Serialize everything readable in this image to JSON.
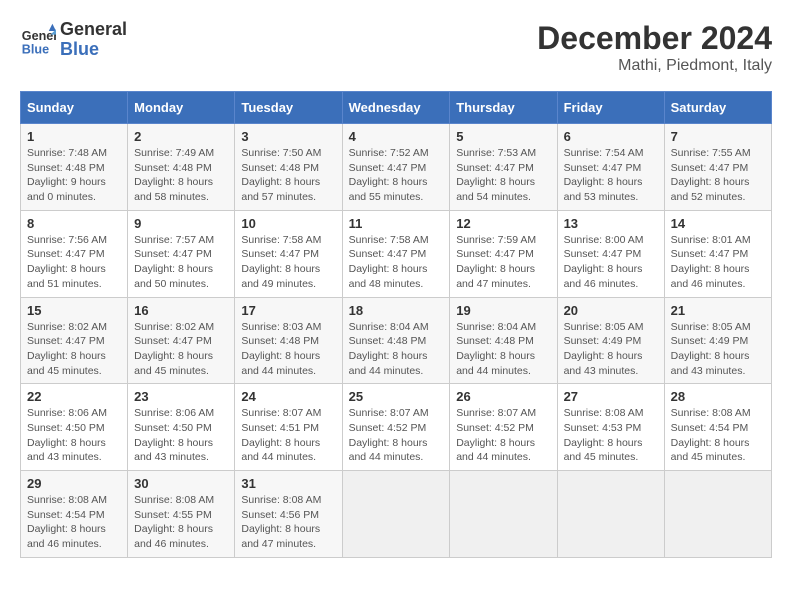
{
  "logo": {
    "line1": "General",
    "line2": "Blue"
  },
  "title": "December 2024",
  "location": "Mathi, Piedmont, Italy",
  "days_of_week": [
    "Sunday",
    "Monday",
    "Tuesday",
    "Wednesday",
    "Thursday",
    "Friday",
    "Saturday"
  ],
  "weeks": [
    [
      {
        "day": "1",
        "sunrise": "7:48 AM",
        "sunset": "4:48 PM",
        "daylight": "9 hours and 0 minutes."
      },
      {
        "day": "2",
        "sunrise": "7:49 AM",
        "sunset": "4:48 PM",
        "daylight": "8 hours and 58 minutes."
      },
      {
        "day": "3",
        "sunrise": "7:50 AM",
        "sunset": "4:48 PM",
        "daylight": "8 hours and 57 minutes."
      },
      {
        "day": "4",
        "sunrise": "7:52 AM",
        "sunset": "4:47 PM",
        "daylight": "8 hours and 55 minutes."
      },
      {
        "day": "5",
        "sunrise": "7:53 AM",
        "sunset": "4:47 PM",
        "daylight": "8 hours and 54 minutes."
      },
      {
        "day": "6",
        "sunrise": "7:54 AM",
        "sunset": "4:47 PM",
        "daylight": "8 hours and 53 minutes."
      },
      {
        "day": "7",
        "sunrise": "7:55 AM",
        "sunset": "4:47 PM",
        "daylight": "8 hours and 52 minutes."
      }
    ],
    [
      {
        "day": "8",
        "sunrise": "7:56 AM",
        "sunset": "4:47 PM",
        "daylight": "8 hours and 51 minutes."
      },
      {
        "day": "9",
        "sunrise": "7:57 AM",
        "sunset": "4:47 PM",
        "daylight": "8 hours and 50 minutes."
      },
      {
        "day": "10",
        "sunrise": "7:58 AM",
        "sunset": "4:47 PM",
        "daylight": "8 hours and 49 minutes."
      },
      {
        "day": "11",
        "sunrise": "7:58 AM",
        "sunset": "4:47 PM",
        "daylight": "8 hours and 48 minutes."
      },
      {
        "day": "12",
        "sunrise": "7:59 AM",
        "sunset": "4:47 PM",
        "daylight": "8 hours and 47 minutes."
      },
      {
        "day": "13",
        "sunrise": "8:00 AM",
        "sunset": "4:47 PM",
        "daylight": "8 hours and 46 minutes."
      },
      {
        "day": "14",
        "sunrise": "8:01 AM",
        "sunset": "4:47 PM",
        "daylight": "8 hours and 46 minutes."
      }
    ],
    [
      {
        "day": "15",
        "sunrise": "8:02 AM",
        "sunset": "4:47 PM",
        "daylight": "8 hours and 45 minutes."
      },
      {
        "day": "16",
        "sunrise": "8:02 AM",
        "sunset": "4:47 PM",
        "daylight": "8 hours and 45 minutes."
      },
      {
        "day": "17",
        "sunrise": "8:03 AM",
        "sunset": "4:48 PM",
        "daylight": "8 hours and 44 minutes."
      },
      {
        "day": "18",
        "sunrise": "8:04 AM",
        "sunset": "4:48 PM",
        "daylight": "8 hours and 44 minutes."
      },
      {
        "day": "19",
        "sunrise": "8:04 AM",
        "sunset": "4:48 PM",
        "daylight": "8 hours and 44 minutes."
      },
      {
        "day": "20",
        "sunrise": "8:05 AM",
        "sunset": "4:49 PM",
        "daylight": "8 hours and 43 minutes."
      },
      {
        "day": "21",
        "sunrise": "8:05 AM",
        "sunset": "4:49 PM",
        "daylight": "8 hours and 43 minutes."
      }
    ],
    [
      {
        "day": "22",
        "sunrise": "8:06 AM",
        "sunset": "4:50 PM",
        "daylight": "8 hours and 43 minutes."
      },
      {
        "day": "23",
        "sunrise": "8:06 AM",
        "sunset": "4:50 PM",
        "daylight": "8 hours and 43 minutes."
      },
      {
        "day": "24",
        "sunrise": "8:07 AM",
        "sunset": "4:51 PM",
        "daylight": "8 hours and 44 minutes."
      },
      {
        "day": "25",
        "sunrise": "8:07 AM",
        "sunset": "4:52 PM",
        "daylight": "8 hours and 44 minutes."
      },
      {
        "day": "26",
        "sunrise": "8:07 AM",
        "sunset": "4:52 PM",
        "daylight": "8 hours and 44 minutes."
      },
      {
        "day": "27",
        "sunrise": "8:08 AM",
        "sunset": "4:53 PM",
        "daylight": "8 hours and 45 minutes."
      },
      {
        "day": "28",
        "sunrise": "8:08 AM",
        "sunset": "4:54 PM",
        "daylight": "8 hours and 45 minutes."
      }
    ],
    [
      {
        "day": "29",
        "sunrise": "8:08 AM",
        "sunset": "4:54 PM",
        "daylight": "8 hours and 46 minutes."
      },
      {
        "day": "30",
        "sunrise": "8:08 AM",
        "sunset": "4:55 PM",
        "daylight": "8 hours and 46 minutes."
      },
      {
        "day": "31",
        "sunrise": "8:08 AM",
        "sunset": "4:56 PM",
        "daylight": "8 hours and 47 minutes."
      },
      null,
      null,
      null,
      null
    ]
  ],
  "labels": {
    "sunrise": "Sunrise: ",
    "sunset": "Sunset: ",
    "daylight": "Daylight: "
  }
}
